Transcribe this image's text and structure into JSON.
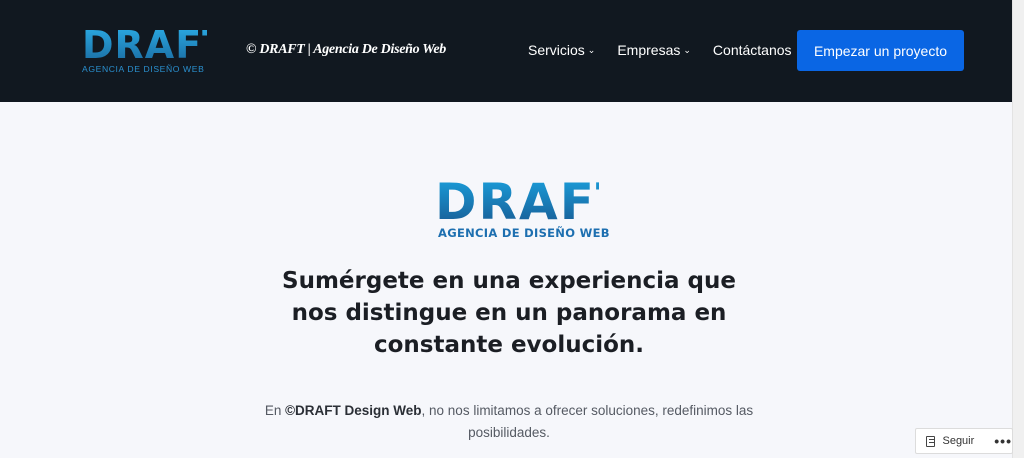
{
  "header": {
    "logo": {
      "word": "DRAFT",
      "tagline": "AGENCIA DE DISEÑO WEB"
    },
    "site_title": "© DRAFT | Agencia De Diseño Web",
    "nav": [
      {
        "label": "Servicios",
        "has_dropdown": true
      },
      {
        "label": "Empresas",
        "has_dropdown": true
      },
      {
        "label": "Contáctanos",
        "has_dropdown": false
      }
    ],
    "cta_label": "Empezar un proyecto"
  },
  "hero": {
    "logo": {
      "word": "DRAFT",
      "tagline": "AGENCIA DE DISEÑO WEB"
    },
    "headline": "Sumérgete en una experiencia que nos distingue en un panorama en constante evolución.",
    "body_prefix": "En ",
    "body_strong": "©DRAFT Design Web",
    "body_suffix": ", no nos limitamos a ofrecer soluciones, redefinimos las posibilidades."
  },
  "follow_widget": {
    "label": "Seguir",
    "more": "•••"
  },
  "colors": {
    "header_bg": "#111820",
    "accent": "#0a66e4",
    "logo_blue": "#1a8fd0",
    "page_bg": "#f6f7fb"
  }
}
